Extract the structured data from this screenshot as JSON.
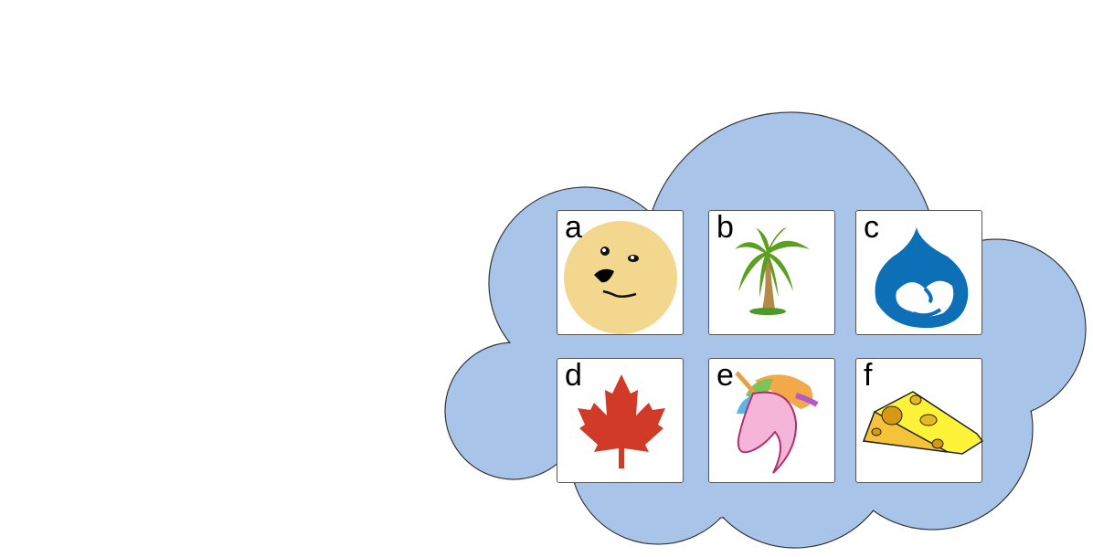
{
  "colors": {
    "cloud_fill": "#a9c4e9",
    "cloud_stroke": "#333333"
  },
  "cards": [
    {
      "label": "a",
      "icon": "doge-face-icon"
    },
    {
      "label": "b",
      "icon": "palm-tree-icon"
    },
    {
      "label": "c",
      "icon": "drupal-drop-icon"
    },
    {
      "label": "d",
      "icon": "maple-leaf-icon"
    },
    {
      "label": "e",
      "icon": "unicorn-head-icon"
    },
    {
      "label": "f",
      "icon": "cheese-icon"
    }
  ]
}
